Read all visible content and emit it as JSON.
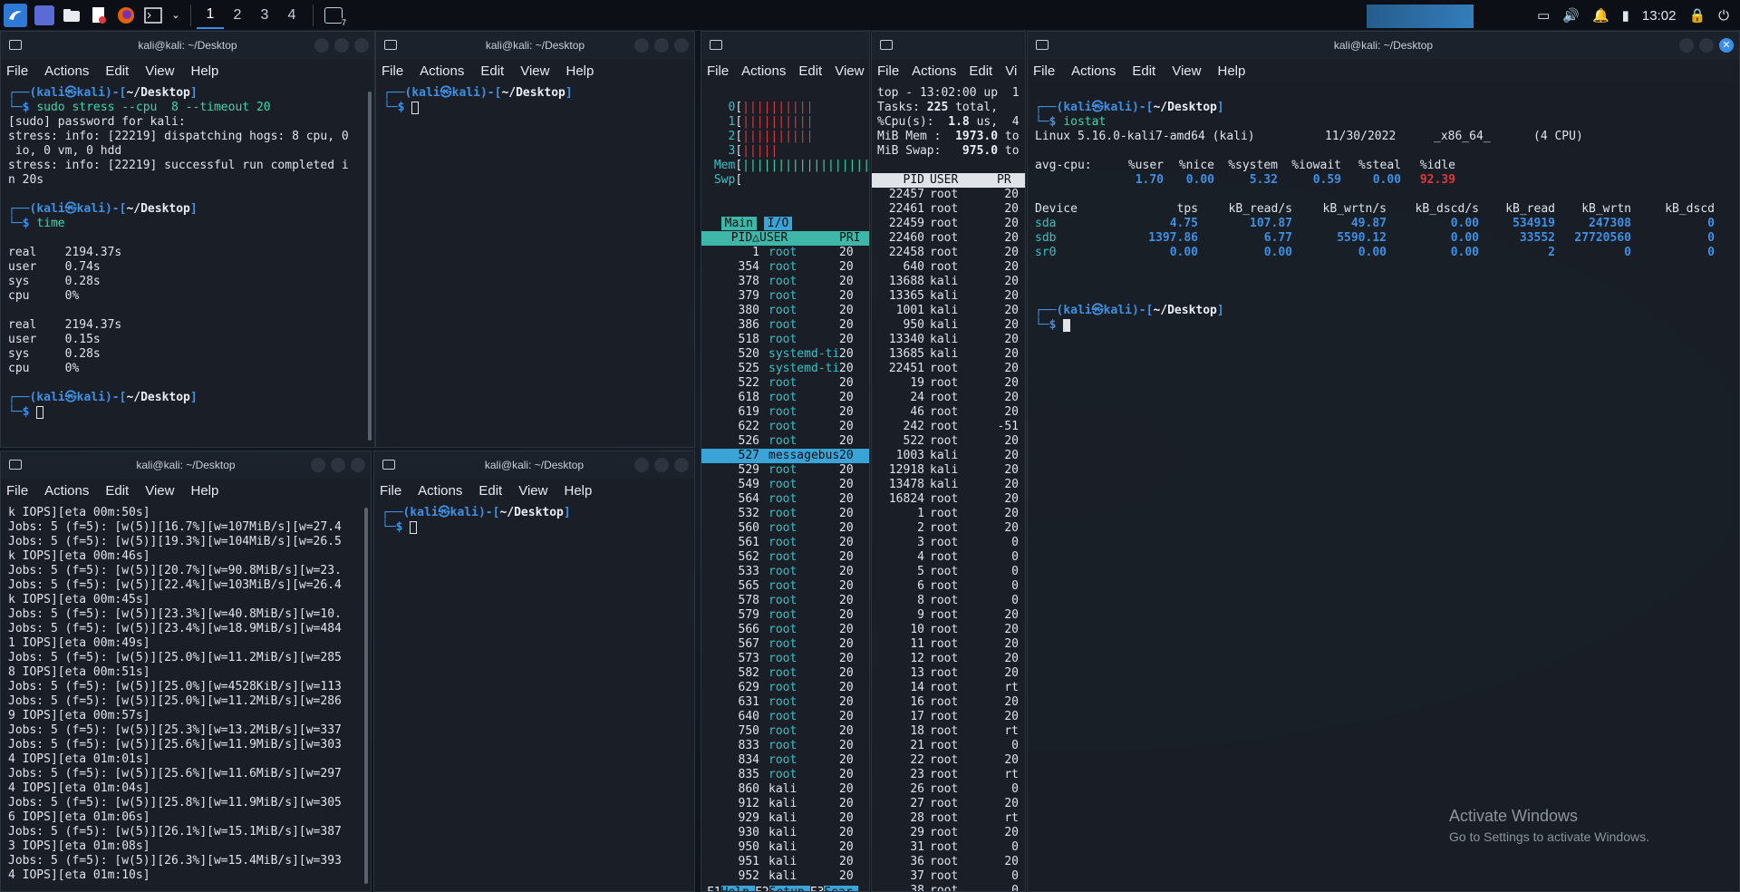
{
  "taskbar": {
    "workspaces": [
      "1",
      "2",
      "3",
      "4"
    ],
    "clock": "13:02",
    "tray_badge": "7"
  },
  "win1": {
    "title": "kali@kali: ~/Desktop",
    "menu": [
      "File",
      "Actions",
      "Edit",
      "View",
      "Help"
    ],
    "lines": [
      {
        "t": "prompt"
      },
      {
        "t": "cmd",
        "cmd": "sudo stress --cpu  8 --timeout 20",
        "u": "sudo"
      },
      {
        "t": "text",
        "v": "[sudo] password for kali:"
      },
      {
        "t": "text",
        "v": "stress: info: [22219] dispatching hogs: 8 cpu, 0"
      },
      {
        "t": "text",
        "v": " io, 0 vm, 0 hdd"
      },
      {
        "t": "text",
        "v": "stress: info: [22219] successful run completed i"
      },
      {
        "t": "text",
        "v": "n 20s"
      },
      {
        "t": "text",
        "v": ""
      },
      {
        "t": "prompt"
      },
      {
        "t": "cmd",
        "cmd": "time"
      },
      {
        "t": "text",
        "v": ""
      },
      {
        "t": "text",
        "v": "real    2194.37s"
      },
      {
        "t": "text",
        "v": "user    0.74s"
      },
      {
        "t": "text",
        "v": "sys     0.28s"
      },
      {
        "t": "text",
        "v": "cpu     0%"
      },
      {
        "t": "text",
        "v": ""
      },
      {
        "t": "text",
        "v": "real    2194.37s"
      },
      {
        "t": "text",
        "v": "user    0.15s"
      },
      {
        "t": "text",
        "v": "sys     0.28s"
      },
      {
        "t": "text",
        "v": "cpu     0%"
      },
      {
        "t": "text",
        "v": ""
      },
      {
        "t": "prompt"
      },
      {
        "t": "cursor"
      }
    ]
  },
  "win2": {
    "title": "kali@kali: ~/Desktop",
    "menu": [
      "File",
      "Actions",
      "Edit",
      "View",
      "Help"
    ]
  },
  "win3": {
    "title": "kali@kali: ~/Desktop",
    "menu": [
      "File",
      "Actions",
      "Edit",
      "View",
      "Help"
    ],
    "lines": [
      "k IOPS][eta 00m:50s]",
      "Jobs: 5 (f=5): [w(5)][16.7%][w=107MiB/s][w=27.4",
      "Jobs: 5 (f=5): [w(5)][19.3%][w=104MiB/s][w=26.5",
      "k IOPS][eta 00m:46s]",
      "Jobs: 5 (f=5): [w(5)][20.7%][w=90.8MiB/s][w=23.",
      "Jobs: 5 (f=5): [w(5)][22.4%][w=103MiB/s][w=26.4",
      "k IOPS][eta 00m:45s]",
      "Jobs: 5 (f=5): [w(5)][23.3%][w=40.8MiB/s][w=10.",
      "Jobs: 5 (f=5): [w(5)][23.4%][w=18.9MiB/s][w=484",
      "1 IOPS][eta 00m:49s]",
      "Jobs: 5 (f=5): [w(5)][25.0%][w=11.2MiB/s][w=285",
      "8 IOPS][eta 00m:51s]",
      "Jobs: 5 (f=5): [w(5)][25.0%][w=4528KiB/s][w=113",
      "Jobs: 5 (f=5): [w(5)][25.0%][w=11.2MiB/s][w=286",
      "9 IOPS][eta 00m:57s]",
      "Jobs: 5 (f=5): [w(5)][25.3%][w=13.2MiB/s][w=337",
      "Jobs: 5 (f=5): [w(5)][25.6%][w=11.9MiB/s][w=303",
      "4 IOPS][eta 01m:01s]",
      "Jobs: 5 (f=5): [w(5)][25.6%][w=11.6MiB/s][w=297",
      "4 IOPS][eta 01m:04s]",
      "Jobs: 5 (f=5): [w(5)][25.8%][w=11.9MiB/s][w=305",
      "6 IOPS][eta 01m:06s]",
      "Jobs: 5 (f=5): [w(5)][26.1%][w=15.1MiB/s][w=387",
      "3 IOPS][eta 01m:08s]",
      "Jobs: 5 (f=5): [w(5)][26.3%][w=15.4MiB/s][w=393",
      "4 IOPS][eta 01m:10s]"
    ]
  },
  "win4": {
    "title": "kali@kali: ~/Desktop",
    "menu": [
      "File",
      "Actions",
      "Edit",
      "View",
      "Help"
    ]
  },
  "prompt": {
    "user": "kali",
    "at": "㉿",
    "host": "kali",
    "path": "~/Desktop",
    "dollar": "$"
  },
  "htop": {
    "menu": [
      "File",
      "Actions",
      "Edit",
      "View"
    ],
    "cpus": [
      {
        "n": "0",
        "bar": "||||||||||"
      },
      {
        "n": "1",
        "bar": "||||||||||"
      },
      {
        "n": "2",
        "bar": "||||||||||"
      },
      {
        "n": "3",
        "bar": "|||||"
      }
    ],
    "mem_label": "Mem",
    "mem_bar": "||||||||||||||||||||||",
    "swp_label": "Swp",
    "swp_bar": "",
    "tabs": [
      "Main",
      "I/O"
    ],
    "header": {
      "pid": "PID△",
      "user": "USER",
      "pri": "PRI"
    },
    "rows": [
      [
        "1",
        "root",
        "20"
      ],
      [
        "354",
        "root",
        "20"
      ],
      [
        "378",
        "root",
        "20"
      ],
      [
        "379",
        "root",
        "20"
      ],
      [
        "380",
        "root",
        "20"
      ],
      [
        "386",
        "root",
        "20"
      ],
      [
        "518",
        "root",
        "20"
      ],
      [
        "520",
        "systemd-ti",
        "20"
      ],
      [
        "525",
        "systemd-ti",
        "20"
      ],
      [
        "522",
        "root",
        "20"
      ],
      [
        "618",
        "root",
        "20"
      ],
      [
        "619",
        "root",
        "20"
      ],
      [
        "622",
        "root",
        "20"
      ],
      [
        "526",
        "root",
        "20"
      ],
      [
        "527",
        "messagebus",
        "20"
      ],
      [
        "529",
        "root",
        "20"
      ],
      [
        "549",
        "root",
        "20"
      ],
      [
        "564",
        "root",
        "20"
      ],
      [
        "532",
        "root",
        "20"
      ],
      [
        "560",
        "root",
        "20"
      ],
      [
        "561",
        "root",
        "20"
      ],
      [
        "562",
        "root",
        "20"
      ],
      [
        "533",
        "root",
        "20"
      ],
      [
        "565",
        "root",
        "20"
      ],
      [
        "578",
        "root",
        "20"
      ],
      [
        "579",
        "root",
        "20"
      ],
      [
        "566",
        "root",
        "20"
      ],
      [
        "567",
        "root",
        "20"
      ],
      [
        "573",
        "root",
        "20"
      ],
      [
        "582",
        "root",
        "20"
      ],
      [
        "629",
        "root",
        "20"
      ],
      [
        "631",
        "root",
        "20"
      ],
      [
        "640",
        "root",
        "20"
      ],
      [
        "750",
        "root",
        "20"
      ],
      [
        "833",
        "root",
        "20"
      ],
      [
        "834",
        "root",
        "20"
      ],
      [
        "835",
        "root",
        "20"
      ],
      [
        "860",
        "kali",
        "20"
      ],
      [
        "912",
        "kali",
        "20"
      ],
      [
        "929",
        "kali",
        "20"
      ],
      [
        "930",
        "kali",
        "20"
      ],
      [
        "950",
        "kali",
        "20"
      ],
      [
        "951",
        "kali",
        "20"
      ],
      [
        "952",
        "kali",
        "20"
      ]
    ],
    "selected_index": 14,
    "fkeys": [
      {
        "k": "F1",
        "l": "Help"
      },
      {
        "k": "F2",
        "l": "Setup"
      },
      {
        "k": "F3",
        "l": "Sear"
      }
    ]
  },
  "top": {
    "menu": [
      "File",
      "Actions",
      "Edit",
      "Vi"
    ],
    "summary": [
      {
        "l": "top - 13:02:00 up  1",
        "b": ""
      },
      {
        "l": "Tasks: ",
        "b": "225",
        "r": " total,   "
      },
      {
        "l": "%Cpu(s):  ",
        "b": "1.8",
        "r": " us,  4"
      },
      {
        "l": "MiB Mem :  ",
        "b": "1973.0",
        "r": " to"
      },
      {
        "l": "MiB Swap:   ",
        "b": "975.0",
        "r": " to"
      }
    ],
    "header": {
      "pid": "PID",
      "user": "USER",
      "pr": "PR"
    },
    "rows": [
      [
        "22457",
        "root",
        "20"
      ],
      [
        "22461",
        "root",
        "20"
      ],
      [
        "22459",
        "root",
        "20"
      ],
      [
        "22460",
        "root",
        "20"
      ],
      [
        "22458",
        "root",
        "20"
      ],
      [
        "640",
        "root",
        "20"
      ],
      [
        "13688",
        "kali",
        "20"
      ],
      [
        "13365",
        "kali",
        "20"
      ],
      [
        "1001",
        "kali",
        "20"
      ],
      [
        "950",
        "kali",
        "20"
      ],
      [
        "13340",
        "kali",
        "20"
      ],
      [
        "13685",
        "kali",
        "20"
      ],
      [
        "22451",
        "root",
        "20"
      ],
      [
        "19",
        "root",
        "20"
      ],
      [
        "24",
        "root",
        "20"
      ],
      [
        "46",
        "root",
        "20"
      ],
      [
        "242",
        "root",
        "-51"
      ],
      [
        "522",
        "root",
        "20"
      ],
      [
        "1003",
        "kali",
        "20"
      ],
      [
        "12918",
        "kali",
        "20"
      ],
      [
        "13478",
        "kali",
        "20"
      ],
      [
        "16824",
        "root",
        "20"
      ],
      [
        "1",
        "root",
        "20"
      ],
      [
        "2",
        "root",
        "20"
      ],
      [
        "3",
        "root",
        "0"
      ],
      [
        "4",
        "root",
        "0"
      ],
      [
        "5",
        "root",
        "0"
      ],
      [
        "6",
        "root",
        "0"
      ],
      [
        "8",
        "root",
        "0"
      ],
      [
        "9",
        "root",
        "20"
      ],
      [
        "10",
        "root",
        "20"
      ],
      [
        "11",
        "root",
        "20"
      ],
      [
        "12",
        "root",
        "20"
      ],
      [
        "13",
        "root",
        "20"
      ],
      [
        "14",
        "root",
        "rt"
      ],
      [
        "16",
        "root",
        "20"
      ],
      [
        "17",
        "root",
        "20"
      ],
      [
        "18",
        "root",
        "rt"
      ],
      [
        "21",
        "root",
        "0"
      ],
      [
        "22",
        "root",
        "20"
      ],
      [
        "23",
        "root",
        "rt"
      ],
      [
        "26",
        "root",
        "0"
      ],
      [
        "27",
        "root",
        "20"
      ],
      [
        "28",
        "root",
        "rt"
      ],
      [
        "29",
        "root",
        "20"
      ],
      [
        "31",
        "root",
        "0"
      ],
      [
        "36",
        "root",
        "20"
      ],
      [
        "37",
        "root",
        "0"
      ],
      [
        "38",
        "root",
        "0"
      ]
    ]
  },
  "iostat": {
    "title": "kali@kali: ~/Desktop",
    "menu": [
      "File",
      "Actions",
      "Edit",
      "View",
      "Help"
    ],
    "cmd": "iostat",
    "sysline": {
      "kernel": "Linux 5.16.0-kali7-amd64 (kali)",
      "date": "11/30/2022",
      "arch": "_x86_64_",
      "cpus": "(4 CPU)"
    },
    "cpu_hdr": [
      "avg-cpu:",
      "%user",
      "%nice",
      "%system",
      "%iowait",
      "%steal",
      "%idle"
    ],
    "cpu_vals": [
      "1.70",
      "0.00",
      "5.32",
      "0.59",
      "0.00",
      "92.39"
    ],
    "dev_hdr": [
      "Device",
      "tps",
      "kB_read/s",
      "kB_wrtn/s",
      "kB_dscd/s",
      "kB_read",
      "kB_wrtn",
      "kB_dscd"
    ],
    "devices": [
      [
        "sda",
        "4.75",
        "107.87",
        "49.87",
        "0.00",
        "534919",
        "247308",
        "0"
      ],
      [
        "sdb",
        "1397.86",
        "6.77",
        "5590.12",
        "0.00",
        "33552",
        "27720560",
        "0"
      ],
      [
        "sr0",
        "0.00",
        "0.00",
        "0.00",
        "0.00",
        "2",
        "0",
        "0"
      ]
    ]
  },
  "watermark": {
    "line1": "Activate Windows",
    "line2": "Go to Settings to activate Windows."
  },
  "colors": {
    "accent": "#3b8ee8",
    "prompt": "#3f8fe2",
    "htop_user": "#34c3c7",
    "idle_red": "#e0383e"
  }
}
